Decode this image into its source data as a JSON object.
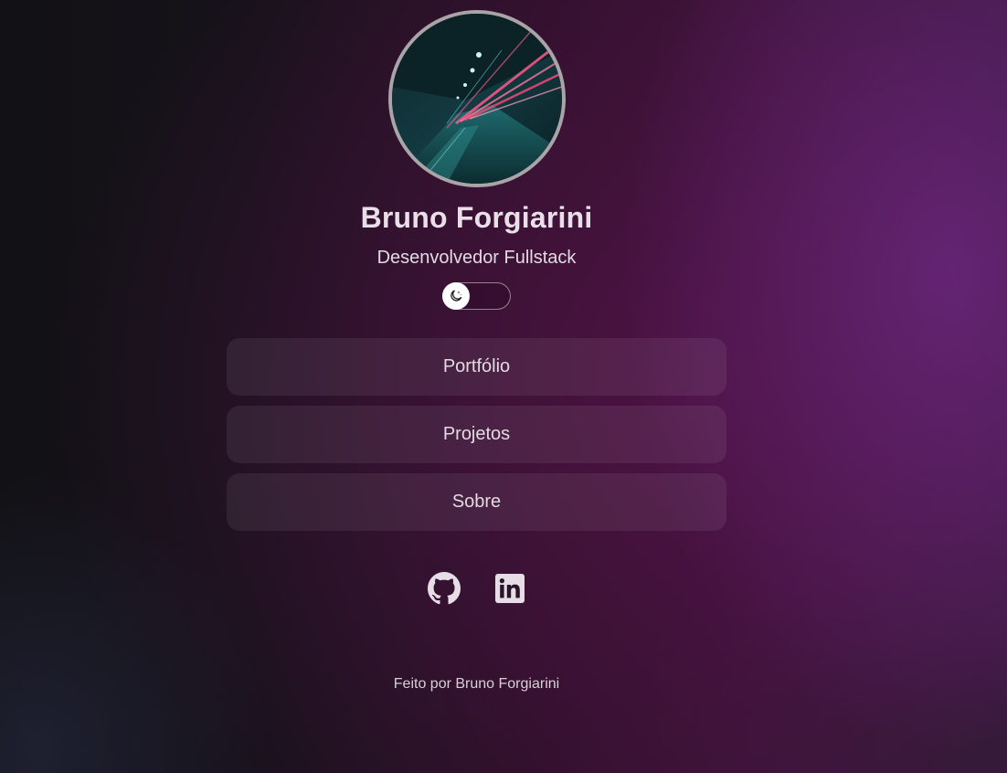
{
  "profile": {
    "name": "Bruno Forgiarini",
    "role": "Desenvolvedor Fullstack"
  },
  "theme_toggle": {
    "icon": "moon-stars-icon",
    "state": "dark"
  },
  "nav": {
    "items": [
      {
        "label": "Portfólio"
      },
      {
        "label": "Projetos"
      },
      {
        "label": "Sobre"
      }
    ]
  },
  "social": [
    {
      "icon": "github-icon"
    },
    {
      "icon": "linkedin-icon"
    }
  ],
  "footer": {
    "text": "Feito por Bruno Forgiarini"
  },
  "colors": {
    "background_dark": "#121115",
    "background_accent": "#5a2470",
    "text": "#e6dde6",
    "avatar_border": "#a9a4a8"
  }
}
